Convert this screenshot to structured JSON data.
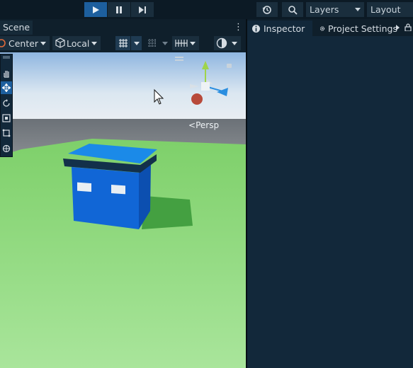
{
  "toolbar": {
    "play_icon": "play-icon",
    "pause_icon": "pause-icon",
    "step_icon": "step-forward-icon",
    "history_icon": "history-icon",
    "search_icon": "search-icon",
    "layers_label": "Layers",
    "layout_label": "Layout"
  },
  "scene": {
    "tab_label": "Scene",
    "kebab": "⋮",
    "pivot_label": "Center",
    "space_label": "Local",
    "persp_label": "Persp"
  },
  "right_panel": {
    "tabs": [
      {
        "label": "Inspector",
        "icon": "inspector-icon"
      },
      {
        "label": "Project Settings",
        "icon": "gear-icon"
      }
    ],
    "lock_icon": "lock-icon"
  },
  "colors": {
    "accent": "#1d5f9e",
    "bg": "#0f1f2b",
    "panel": "#12283a",
    "cube": "#1166d6"
  }
}
